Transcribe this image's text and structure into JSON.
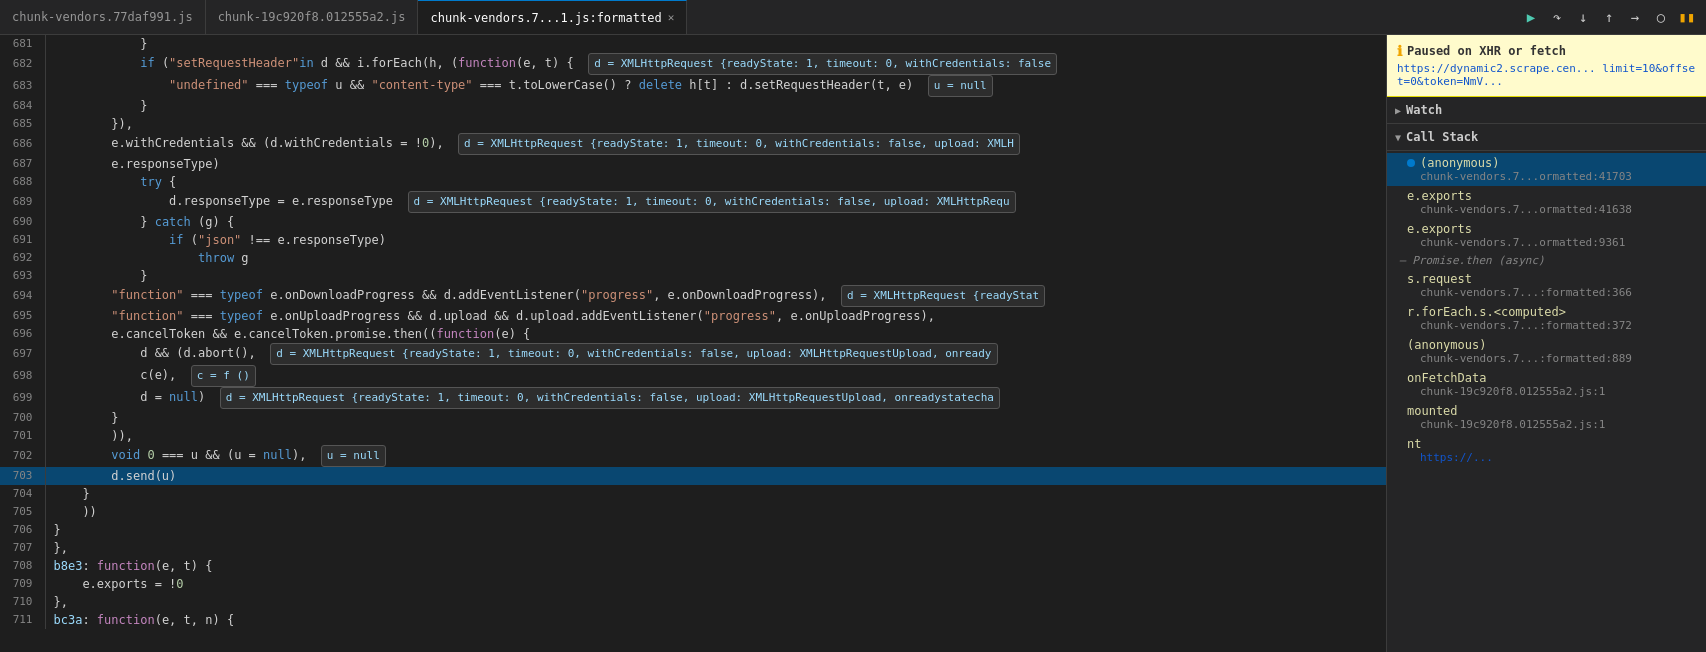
{
  "tabs": [
    {
      "label": "chunk-vendors.77daf991.js",
      "active": false,
      "closeable": false
    },
    {
      "label": "chunk-19c920f8.012555a2.js",
      "active": false,
      "closeable": false
    },
    {
      "label": "chunk-vendors.7...1.js:formatted",
      "active": true,
      "closeable": true
    }
  ],
  "toolbar": {
    "resume": "▶",
    "step_over": "↷",
    "step_into": "↓",
    "step_out": "↑",
    "step_next": "→",
    "deactivate": "⊘",
    "pause": "⏸"
  },
  "pause_banner": {
    "icon": "ℹ",
    "title": "Paused on XHR or fetch",
    "url": "https://dynamic2.scrape.cen... limit=10&offset=0&token=NmV..."
  },
  "watch_section": {
    "label": "Watch",
    "collapsed": true
  },
  "call_stack_section": {
    "label": "Call Stack",
    "collapsed": false
  },
  "call_stack_items": [
    {
      "fn": "(anonymous)",
      "loc": "chunk-vendors.7...ormatted:41703",
      "active": true,
      "dot": true
    },
    {
      "fn": "e.exports",
      "loc": "chunk-vendors.7...ormatted:41638",
      "active": false,
      "dot": false
    },
    {
      "fn": "e.exports",
      "loc": "chunk-vendors.7...ormatted:9361",
      "active": false,
      "dot": false
    },
    {
      "divider": "Promise.then (async)"
    },
    {
      "fn": "s.request",
      "loc": "chunk-vendors.7...:formatted:366",
      "active": false,
      "dot": false
    },
    {
      "fn": "r.forEach.s.<computed>",
      "loc": "chunk-vendors.7...:formatted:372",
      "active": false,
      "dot": false
    },
    {
      "fn": "(anonymous)",
      "loc": "chunk-vendors.7...:formatted:889",
      "active": false,
      "dot": false
    },
    {
      "fn": "onFetchData",
      "loc": "chunk-19c920f8.012555a2.js:1",
      "active": false,
      "dot": false
    },
    {
      "fn": "mounted",
      "loc": "chunk-19c920f8.012555a2.js:1",
      "active": false,
      "dot": false
    },
    {
      "fn": "nt",
      "loc": "https://...",
      "active": false,
      "dot": false
    }
  ],
  "code_lines": [
    {
      "num": 681,
      "content": "            }",
      "highlight": false
    },
    {
      "num": 682,
      "content": "            if (\"setRequestHeader\"in d && i.forEach(h, (function(e, t) {  d = XMLHttpRequest {readyState: 1, timeout: 0, withCredentials: fals",
      "highlight": false,
      "has_tooltip": true
    },
    {
      "num": 683,
      "content": "                \"undefined\" === typeof u && \"content-type\" === t.toLowerCase() ? delete h[t] : d.setRequestHeader(t, e)  u = null",
      "highlight": false,
      "has_tooltip2": true
    },
    {
      "num": 684,
      "content": "            }",
      "highlight": false
    },
    {
      "num": 685,
      "content": "        }),",
      "highlight": false
    },
    {
      "num": 686,
      "content": "        e.withCredentials && (d.withCredentials = !0),  d = XMLHttpRequest {readyState: 1, timeout: 0, withCredentials: false, upload: XMLH",
      "highlight": false,
      "has_tooltip": true
    },
    {
      "num": 687,
      "content": "        e.responseType)",
      "highlight": false
    },
    {
      "num": 688,
      "content": "            try {",
      "highlight": false
    },
    {
      "num": 689,
      "content": "                d.responseType = e.responseType  d = XMLHttpRequest {readyState: 1, timeout: 0, withCredentials: false, upload: XMLHttpRequ",
      "highlight": false,
      "has_tooltip": true
    },
    {
      "num": 690,
      "content": "            } catch (g) {",
      "highlight": false
    },
    {
      "num": 691,
      "content": "                if (\"json\" !== e.responseType)",
      "highlight": false
    },
    {
      "num": 692,
      "content": "                    throw g",
      "highlight": false
    },
    {
      "num": 693,
      "content": "            }",
      "highlight": false
    },
    {
      "num": 694,
      "content": "        \"function\" === typeof e.onDownloadProgress && d.addEventListener(\"progress\", e.onDownloadProgress),  d = XMLHttpRequest {readyStat",
      "highlight": false,
      "has_tooltip": true
    },
    {
      "num": 695,
      "content": "        \"function\" === typeof e.onUploadProgress && d.upload && d.upload.addEventListener(\"progress\", e.onUploadProgress),",
      "highlight": false
    },
    {
      "num": 696,
      "content": "        e.cancelToken && e.cancelToken.promise.then((function(e) {",
      "highlight": false
    },
    {
      "num": 697,
      "content": "            d && (d.abort(),  d = XMLHttpRequest {readyState: 1, timeout: 0, withCredentials: false, upload: XMLHttpRequestUpload, onready",
      "highlight": false,
      "has_tooltip": true
    },
    {
      "num": 698,
      "content": "            c(e),  c = f ()",
      "highlight": false,
      "has_tooltip": true
    },
    {
      "num": 699,
      "content": "            d = null)  d = XMLHttpRequest {readyState: 1, timeout: 0, withCredentials: false, upload: XMLHttpRequestUpload, onreadystatecha",
      "highlight": false,
      "has_tooltip": true
    },
    {
      "num": 700,
      "content": "        }",
      "highlight": false
    },
    {
      "num": 701,
      "content": "        }),",
      "highlight": false
    },
    {
      "num": 702,
      "content": "        void 0 === u && (u = null),  u = null",
      "highlight": false,
      "has_tooltip": true
    },
    {
      "num": 703,
      "content": "        d.send(u)",
      "highlight": true
    },
    {
      "num": 704,
      "content": "    }",
      "highlight": false
    },
    {
      "num": 705,
      "content": "    ))",
      "highlight": false
    },
    {
      "num": 706,
      "content": "}",
      "highlight": false
    },
    {
      "num": 707,
      "content": "},",
      "highlight": false
    },
    {
      "num": 708,
      "content": "b8e3: function(e, t) {",
      "highlight": false
    },
    {
      "num": 709,
      "content": "    e.exports = !0",
      "highlight": false
    },
    {
      "num": 710,
      "content": "},",
      "highlight": false
    },
    {
      "num": 711,
      "content": "bc3a: function(e, t, n) {",
      "highlight": false
    }
  ]
}
